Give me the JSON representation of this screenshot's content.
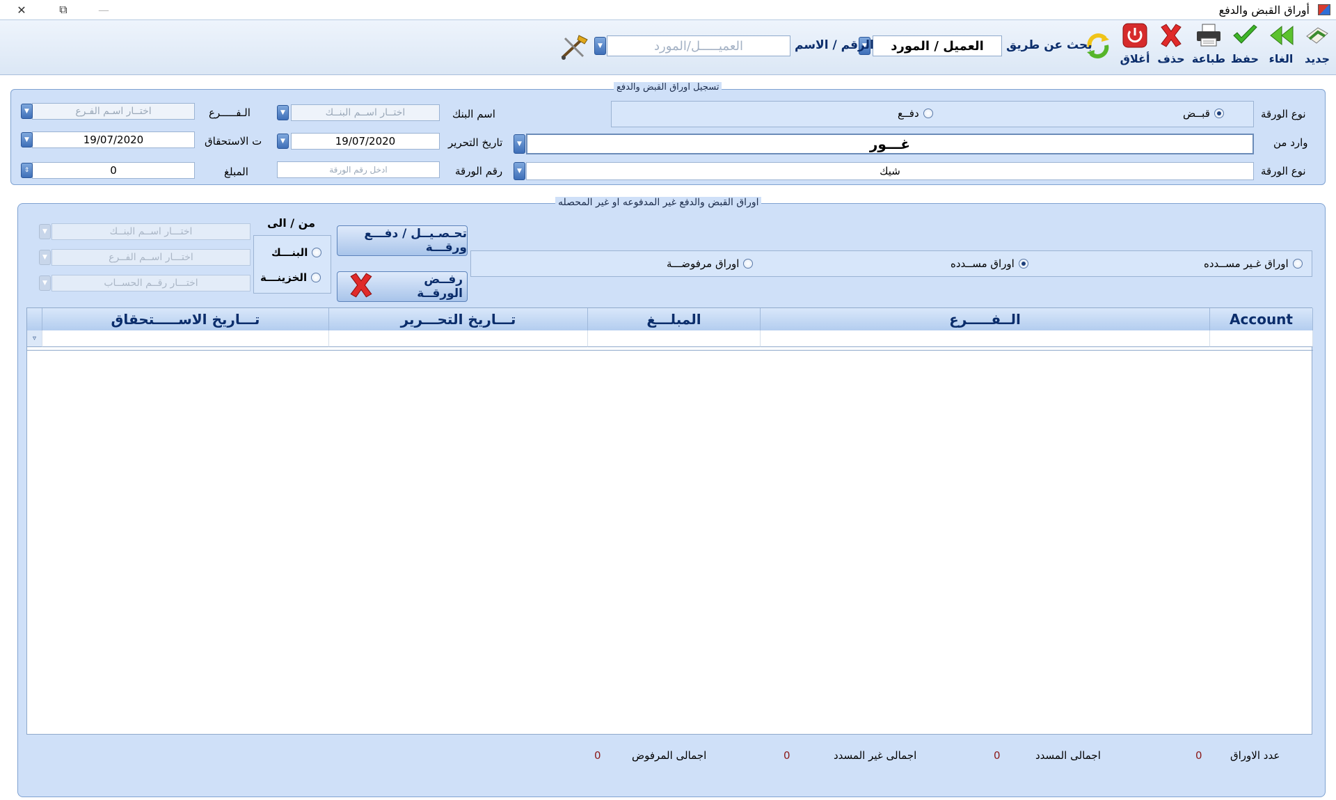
{
  "window": {
    "title": "أوراق القبض والدفع",
    "minimize": "—",
    "maximize": "⧉",
    "close": "✕"
  },
  "toolbar": {
    "new": "جديد",
    "cancel": "الغاء",
    "save": "حفظ",
    "print": "طباعة",
    "delete": "حذف",
    "close": "أغلاق",
    "search_by_label": "بحث عن طريق",
    "search_by_value": "العميل / المورد",
    "number_name_label": "الرقم / الاسم",
    "customer_supplier_placeholder": "العميـــــل/المورد"
  },
  "icons": {
    "new": "new-doc-icon",
    "cancel": "back-arrows-icon",
    "save": "checkmark-icon",
    "print": "printer-icon",
    "delete": "red-x-icon",
    "close": "power-icon",
    "refresh": "refresh-icon",
    "tools": "tools-icon"
  },
  "register": {
    "group_title": "تسجيل اوراق القبض والدفع",
    "paper_type_label": "نوع الورقة",
    "receipt_label": "قبــض",
    "payment_label": "دفــع",
    "receipt_selected": true,
    "received_from_label": "وارد من",
    "received_from_value": "غـــور",
    "paper_kind_label": "نوع الورقة",
    "paper_kind_value": "شيك",
    "bank_name_label": "اسم البنك",
    "bank_name_placeholder": "اختــار اســم البنــك",
    "write_date_label": "تاريخ التحرير",
    "write_date_value": "19/07/2020",
    "paper_number_label": "رقم الورقة",
    "paper_number_placeholder": "ادخل رقم الورقة",
    "branch_label": "الـفـــــرع",
    "branch_placeholder": "اختــار اسـم الفـرع",
    "due_date_label": "ت الاستحقاق",
    "due_date_value": "19/07/2020",
    "amount_label": "المبلغ",
    "amount_value": "0"
  },
  "unpaid": {
    "group_title": "اوراق القبض والدفع غير المدفوعه او غير المحصله",
    "filter_unpaid": "اوراق غـير مســدده",
    "filter_paid": "اوراق مســدده",
    "filter_rejected": "اوراق مرفوضـــة",
    "selected_filter": "paid",
    "collect_button": "تحـصـيــل / دفـــع ورقـــة",
    "reject_button": "رفــض الورقــة",
    "from_to_label": "من / الى",
    "bank_option": "البنـــك",
    "treasury_option": "الخزينـــة",
    "bank_select_placeholder": "اختـــار اســم البنــك",
    "branch_select_placeholder": "اختـــار اســم الفــرع",
    "account_select_placeholder": "اختـــار رقــم الحســاب"
  },
  "grid": {
    "columns": [
      "Account",
      "الــفـــــرع",
      "المبلـــغ",
      "تـــاريخ التحـــرير",
      "تـــاريخ الاســـــتحقاق"
    ]
  },
  "totals": {
    "count_label": "عدد الاوراق",
    "count_value": "0",
    "paid_label": "اجمالى المسدد",
    "paid_value": "0",
    "unpaid_label": "اجمالى غير المسدد",
    "unpaid_value": "0",
    "rejected_label": "اجمالى المرفوض",
    "rejected_value": "0"
  }
}
